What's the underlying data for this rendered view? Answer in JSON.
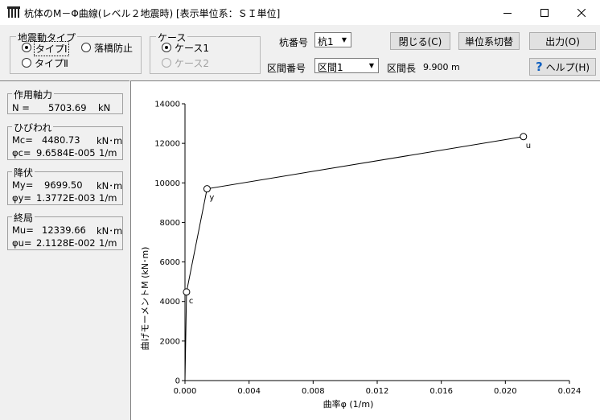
{
  "window": {
    "title": "杭体のM－Φ曲線(レベル２地震時) [表示単位系：ＳＩ単位]",
    "min_icon": "minimize-icon",
    "max_icon": "maximize-icon",
    "close_icon": "close-icon"
  },
  "eq_type": {
    "legend": "地震動タイプ",
    "opt1": "タイプⅠ",
    "opt2": "落橋防止",
    "opt3": "タイプⅡ"
  },
  "case": {
    "legend": "ケース",
    "opt1": "ケース1",
    "opt2": "ケース2"
  },
  "pile": {
    "label": "杭番号",
    "value": "杭1"
  },
  "section": {
    "label": "区間番号",
    "value": "区間1",
    "length_label": "区間長",
    "length_value": "9.900 m"
  },
  "buttons": {
    "close": "閉じる(C)",
    "unit": "単位系切替",
    "output": "出力(O)",
    "help": "ヘルプ(H)"
  },
  "axial": {
    "legend": "作用軸力",
    "label": "N =",
    "value": "5703.69",
    "unit": "kN"
  },
  "crack": {
    "legend": "ひびわれ",
    "m_label": "Mc=",
    "m_value": "4480.73",
    "m_unit": "kN･m",
    "p_label": "φc=",
    "p_value": "9.6584E-005",
    "p_unit": "1/m"
  },
  "yield": {
    "legend": "降伏",
    "m_label": "My=",
    "m_value": "9699.50",
    "m_unit": "kN･m",
    "p_label": "φy=",
    "p_value": "1.3772E-003",
    "p_unit": "1/m"
  },
  "ultimate": {
    "legend": "終局",
    "m_label": "Mu=",
    "m_value": "12339.66",
    "m_unit": "kN･m",
    "p_label": "φu=",
    "p_value": "2.1128E-002",
    "p_unit": "1/m"
  },
  "chart_data": {
    "type": "line",
    "xlabel": "曲率φ (1/m)",
    "ylabel": "曲げモーメントM (kN･m)",
    "xlim": [
      0,
      0.024
    ],
    "ylim": [
      0,
      14000
    ],
    "xticks": [
      0,
      0.004,
      0.008,
      0.012,
      0.016,
      0.02,
      0.024
    ],
    "xtick_labels": [
      "0.000",
      "0.004",
      "0.008",
      "0.012",
      "0.016",
      "0.020",
      "0.024"
    ],
    "yticks": [
      0,
      2000,
      4000,
      6000,
      8000,
      10000,
      12000,
      14000
    ],
    "ytick_labels": [
      "0",
      "2000",
      "4000",
      "6000",
      "8000",
      "10000",
      "12000",
      "14000"
    ],
    "grid": false,
    "x": [
      0,
      9.6584e-05,
      0.0013772,
      0.021128
    ],
    "y": [
      0,
      4480.73,
      9699.5,
      12339.66
    ],
    "point_labels": [
      "",
      "c",
      "y",
      "u"
    ]
  }
}
